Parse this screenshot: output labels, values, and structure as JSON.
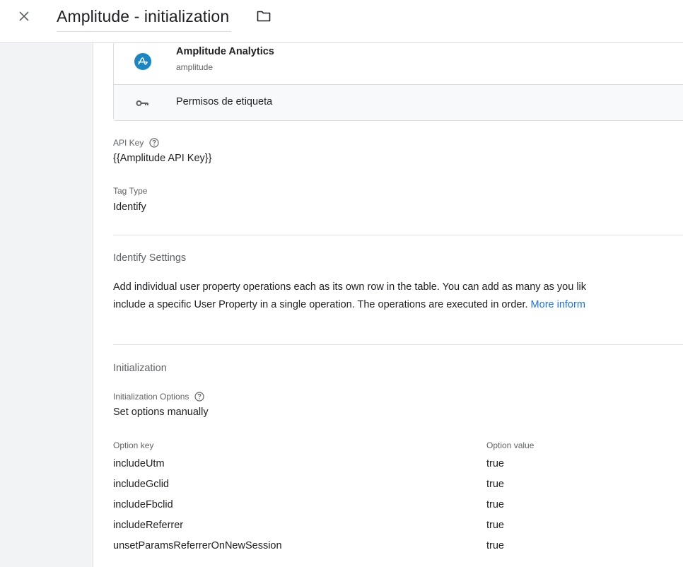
{
  "header": {
    "title": "Amplitude - initialization",
    "close_icon": "close-icon",
    "folder_icon": "folder-icon"
  },
  "template_card": {
    "name": "Amplitude Analytics",
    "subtitle": "amplitude",
    "permissions_label": "Permisos de etiqueta",
    "logo_color": "#1a87c4"
  },
  "fields": {
    "api_key_label": "API Key",
    "api_key_value": "{{Amplitude API Key}}",
    "tag_type_label": "Tag Type",
    "tag_type_value": "Identify"
  },
  "identify_settings": {
    "title": "Identify Settings",
    "line1": "Add individual user property operations each as its own row in the table. You can add as many as you lik",
    "line2": "include a specific User Property in a single operation. The operations are executed in order.",
    "link": "More inform"
  },
  "initialization": {
    "title": "Initialization",
    "options_label": "Initialization Options",
    "options_value": "Set options manually",
    "col_key": "Option key",
    "col_value": "Option value",
    "rows": [
      {
        "key": "includeUtm",
        "value": "true"
      },
      {
        "key": "includeGclid",
        "value": "true"
      },
      {
        "key": "includeFbclid",
        "value": "true"
      },
      {
        "key": "includeReferrer",
        "value": "true"
      },
      {
        "key": "unsetParamsReferrerOnNewSession",
        "value": "true"
      }
    ]
  },
  "colors": {
    "link": "#1a73e8",
    "sidebar": "#f1f3f4",
    "text": "#202124",
    "muted": "#5f6368"
  }
}
